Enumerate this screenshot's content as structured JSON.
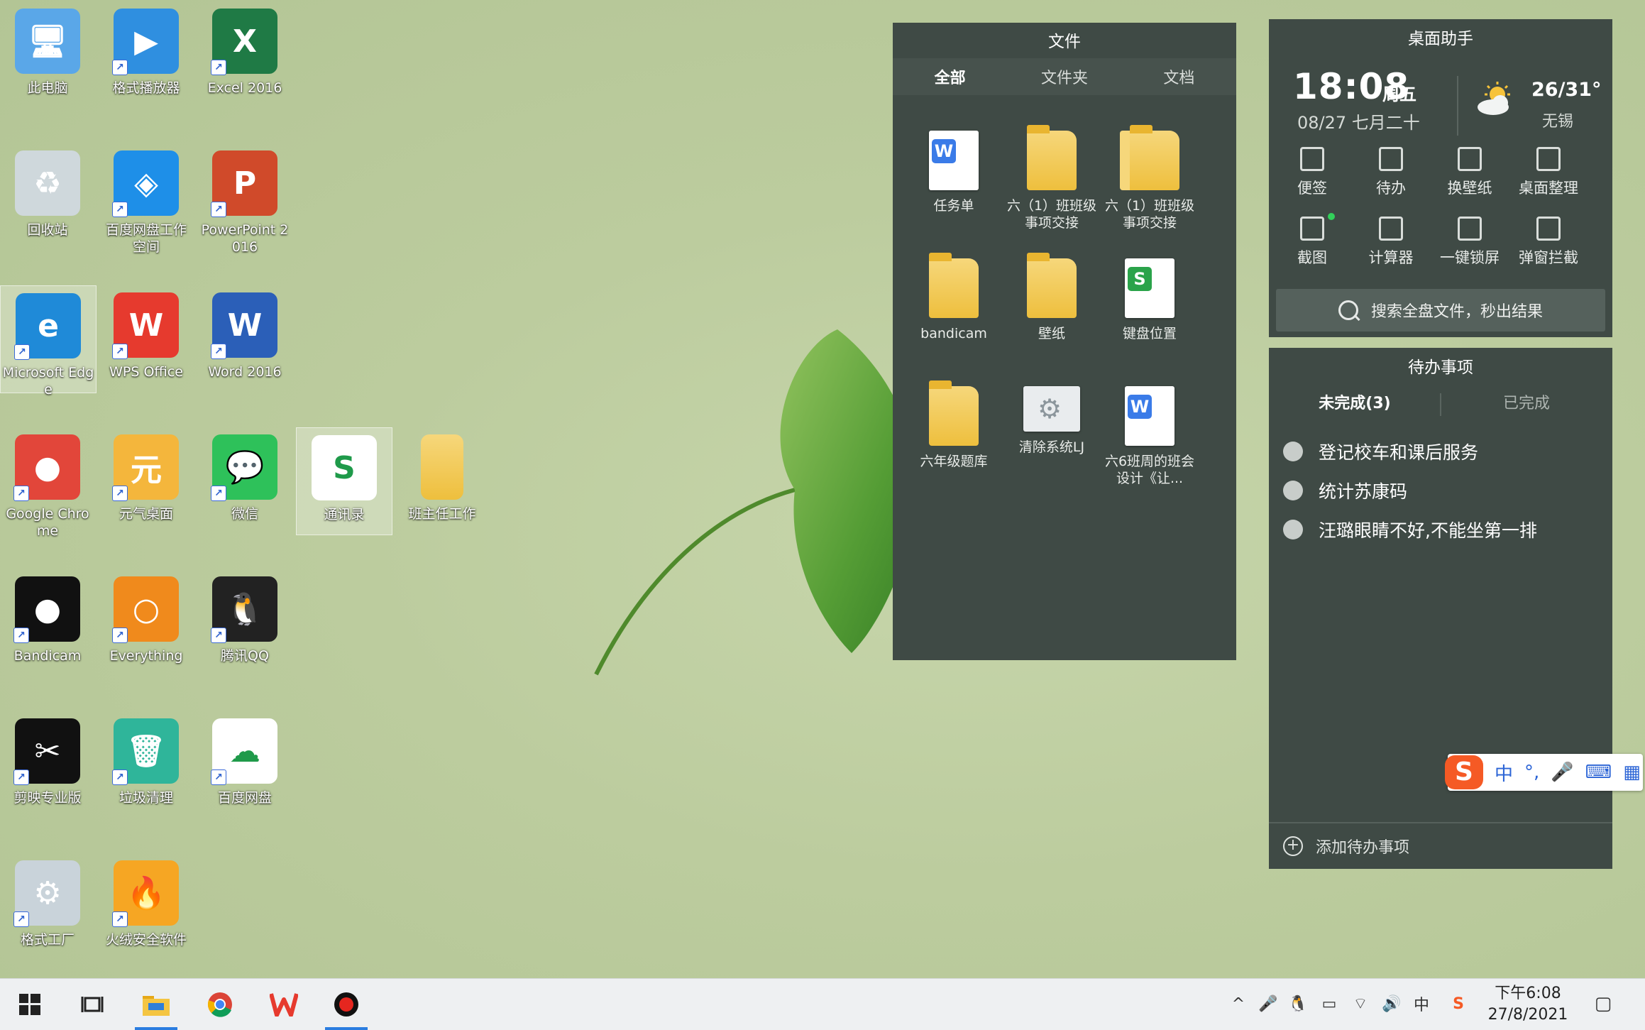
{
  "desktop_icons": [
    {
      "label": "此电脑",
      "icon": "computer-icon",
      "color": "#5aa7e8"
    },
    {
      "label": "格式播放器",
      "icon": "player-icon",
      "color": "#2f8fe0"
    },
    {
      "label": "Excel 2016",
      "icon": "excel-icon",
      "color": "#1f7a45"
    },
    {
      "label": "回收站",
      "icon": "recycle-bin-icon",
      "color": "#cfd8dc"
    },
    {
      "label": "百度网盘工作空间",
      "icon": "baidu-workspace-icon",
      "color": "#1e8fe8"
    },
    {
      "label": "PowerPoint 2016",
      "icon": "powerpoint-icon",
      "color": "#d04a2a"
    },
    {
      "label": "Microsoft Edge",
      "icon": "edge-icon",
      "color": "#1f8ad8"
    },
    {
      "label": "WPS Office",
      "icon": "wps-icon",
      "color": "#e63a2e"
    },
    {
      "label": "Word 2016",
      "icon": "word-icon",
      "color": "#2b5fb8"
    },
    {
      "label": "Google Chrome",
      "icon": "chrome-icon",
      "color": "#e2463a"
    },
    {
      "label": "元气桌面",
      "icon": "yuanqi-icon",
      "color": "#f4b63c"
    },
    {
      "label": "微信",
      "icon": "wechat-icon",
      "color": "#2ec15a"
    },
    {
      "label": "通讯录",
      "icon": "sheet-file-icon",
      "color": "#ffffff"
    },
    {
      "label": "班主任工作",
      "icon": "folder-icon",
      "color": "#f2cc5c"
    },
    {
      "label": "Bandicam",
      "icon": "bandicam-icon",
      "color": "#111111"
    },
    {
      "label": "Everything",
      "icon": "everything-icon",
      "color": "#f08a1c"
    },
    {
      "label": "腾讯QQ",
      "icon": "qq-icon",
      "color": "#222222"
    },
    {
      "label": "剪映专业版",
      "icon": "capcut-icon",
      "color": "#111111"
    },
    {
      "label": "垃圾清理",
      "icon": "trash-cleaner-icon",
      "color": "#2fb59a"
    },
    {
      "label": "百度网盘",
      "icon": "baidu-netdisk-icon",
      "color": "#ffffff"
    },
    {
      "label": "格式工厂",
      "icon": "format-factory-icon",
      "color": "#c9d3da"
    },
    {
      "label": "火绒安全软件",
      "icon": "huorong-icon",
      "color": "#f6a623"
    }
  ],
  "files_panel": {
    "title": "文件",
    "tabs": [
      "全部",
      "文件夹",
      "文档"
    ],
    "active_tab": 0,
    "items": [
      {
        "name": "任务单",
        "type": "word"
      },
      {
        "name": "六（1）班班级事项交接",
        "type": "folder"
      },
      {
        "name": "六（1）班班级事项交接",
        "type": "zip"
      },
      {
        "name": "bandicam",
        "type": "folder"
      },
      {
        "name": "壁纸",
        "type": "folder"
      },
      {
        "name": "键盘位置",
        "type": "sheet"
      },
      {
        "name": "六年级题库",
        "type": "folder"
      },
      {
        "name": "清除系统LJ",
        "type": "settings"
      },
      {
        "name": "六6班周的班会设计《让...",
        "type": "word"
      }
    ]
  },
  "assistant": {
    "title": "桌面助手",
    "time": "18:08",
    "weekday": "周五",
    "date": "08/27 七月二十",
    "temperature": "26/31°",
    "city": "无锡",
    "tools": [
      {
        "label": "便签",
        "icon": "note-icon"
      },
      {
        "label": "待办",
        "icon": "todo-check-icon"
      },
      {
        "label": "换壁纸",
        "icon": "wallpaper-icon"
      },
      {
        "label": "桌面整理",
        "icon": "desktop-organize-icon"
      },
      {
        "label": "截图",
        "icon": "screenshot-icon"
      },
      {
        "label": "计算器",
        "icon": "calculator-icon"
      },
      {
        "label": "一键锁屏",
        "icon": "lock-icon"
      },
      {
        "label": "弹窗拦截",
        "icon": "popup-block-icon"
      }
    ],
    "search_placeholder": "搜索全盘文件，秒出结果"
  },
  "todo": {
    "title": "待办事项",
    "tabs": [
      "未完成(3)",
      "已完成"
    ],
    "items": [
      "登记校车和课后服务",
      "统计苏康码",
      "汪璐眼睛不好,不能坐第一排"
    ],
    "add_label": "添加待办事项"
  },
  "ime": {
    "logo": "S",
    "items": [
      "中",
      "°,",
      "🎤",
      "⌨",
      "▦"
    ]
  },
  "taskbar": {
    "apps": [
      {
        "name": "start-button",
        "icon": "windows-icon"
      },
      {
        "name": "task-view-button",
        "icon": "task-view-icon"
      },
      {
        "name": "file-explorer-button",
        "icon": "folder-icon",
        "active": true
      },
      {
        "name": "chrome-button",
        "icon": "chrome-icon"
      },
      {
        "name": "wps-button",
        "icon": "wps-icon"
      },
      {
        "name": "bandicam-button",
        "icon": "bandicam-icon",
        "active": true
      }
    ],
    "tray_input": "中",
    "clock_time": "下午6:08",
    "clock_date": "27/8/2021"
  }
}
